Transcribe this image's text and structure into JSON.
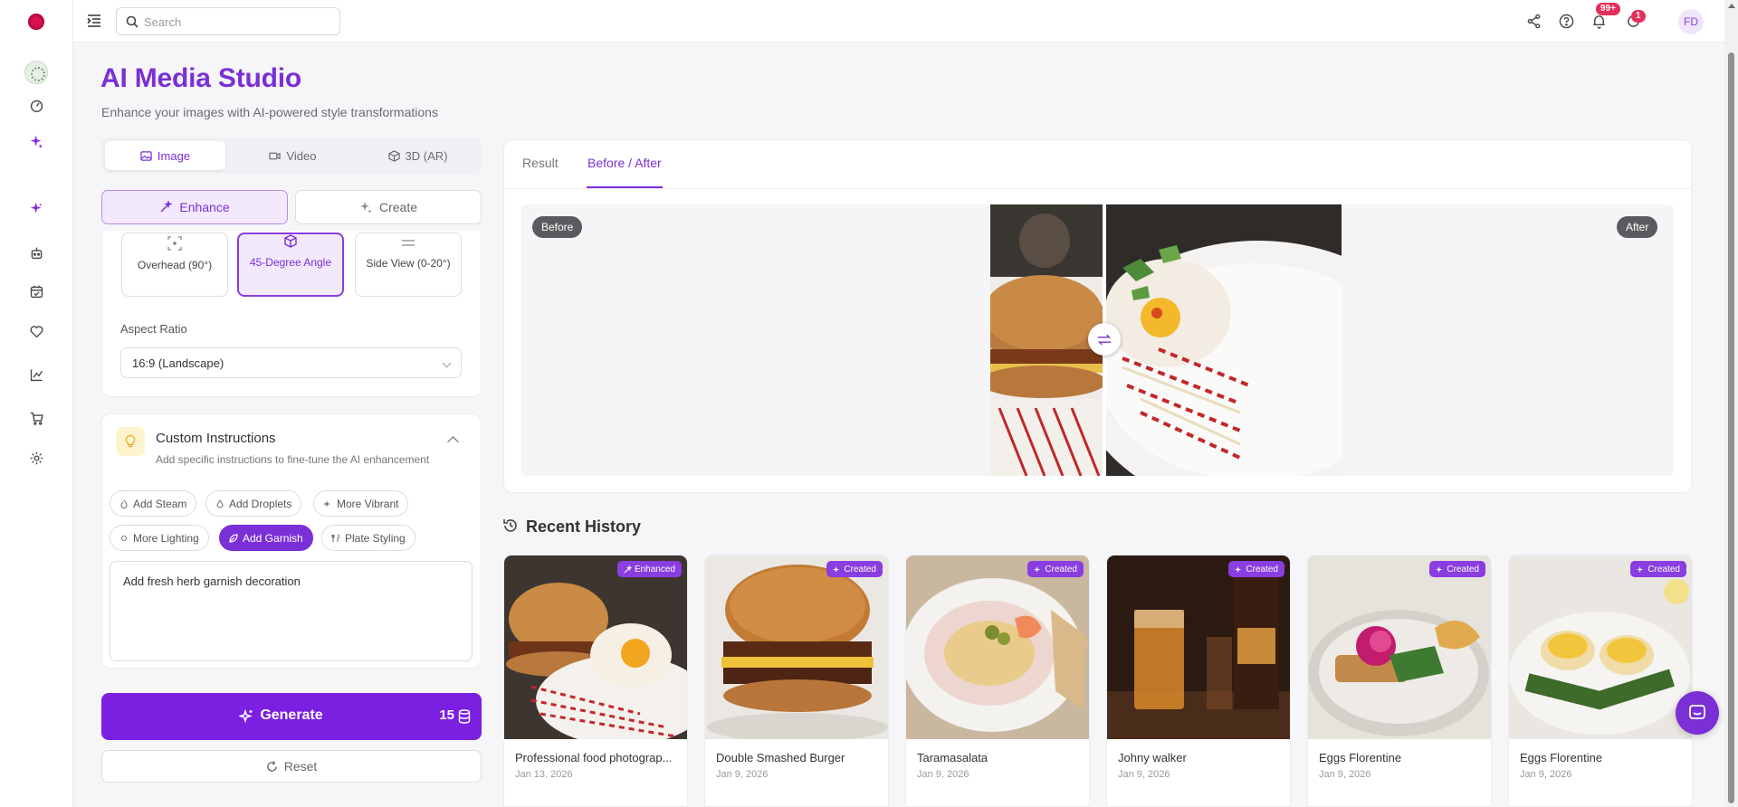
{
  "app": {
    "title": "AI Media Studio",
    "subtitle": "Enhance your images with AI-powered style transformations"
  },
  "topbar": {
    "search_placeholder": "Search",
    "notifications_badge": "99+",
    "alerts_badge": "1",
    "user_initials": "FD"
  },
  "mode_tabs": [
    {
      "label": "Image",
      "icon": "image-icon",
      "active": true
    },
    {
      "label": "Video",
      "icon": "video-icon",
      "active": false
    },
    {
      "label": "3D (AR)",
      "icon": "cube-icon",
      "active": false
    }
  ],
  "sub_modes": [
    {
      "label": "Enhance",
      "icon": "magic-wand-icon",
      "active": true
    },
    {
      "label": "Create",
      "icon": "sparkle-icon",
      "active": false
    }
  ],
  "angles": [
    {
      "label": "Overhead (90°)",
      "icon": "overhead-icon",
      "active": false
    },
    {
      "label": "45-Degree Angle",
      "icon": "angle-icon",
      "active": true
    },
    {
      "label": "Side View (0-20°)",
      "icon": "side-view-icon",
      "active": false
    }
  ],
  "aspect_ratio": {
    "label": "Aspect Ratio",
    "value": "16:9 (Landscape)"
  },
  "custom_instructions": {
    "title": "Custom Instructions",
    "subtitle": "Add specific instructions to fine-tune the AI enhancement",
    "chips": [
      {
        "label": "Add Steam",
        "active": false
      },
      {
        "label": "Add Droplets",
        "active": false
      },
      {
        "label": "More Vibrant",
        "active": false
      },
      {
        "label": "More Lighting",
        "active": false
      },
      {
        "label": "Add Garnish",
        "active": true
      },
      {
        "label": "Plate Styling",
        "active": false
      }
    ],
    "text": "Add fresh herb garnish decoration"
  },
  "actions": {
    "generate_label": "Generate",
    "generate_credits": "15",
    "reset_label": "Reset"
  },
  "result": {
    "tabs": [
      {
        "label": "Result",
        "active": false
      },
      {
        "label": "Before / After",
        "active": true
      }
    ],
    "before_label": "Before",
    "after_label": "After"
  },
  "history": {
    "title": "Recent History",
    "items": [
      {
        "name": "Professional food photograp...",
        "date": "Jan 13, 2026",
        "tag": "Enhanced"
      },
      {
        "name": "Double Smashed Burger",
        "date": "Jan 9, 2026",
        "tag": "Created"
      },
      {
        "name": "Taramasalata",
        "date": "Jan 9, 2026",
        "tag": "Created"
      },
      {
        "name": "Johny walker",
        "date": "Jan 9, 2026",
        "tag": "Created"
      },
      {
        "name": "Eggs Florentine",
        "date": "Jan 9, 2026",
        "tag": "Created"
      },
      {
        "name": "Eggs Florentine",
        "date": "Jan 9, 2026",
        "tag": "Created"
      }
    ]
  },
  "colors": {
    "accent": "#7b2fd6",
    "accent_dark": "#7b1fe0",
    "accent_light": "#f3e9fd",
    "badge": "#e52e5a",
    "brand_logo": "#d8124e"
  }
}
